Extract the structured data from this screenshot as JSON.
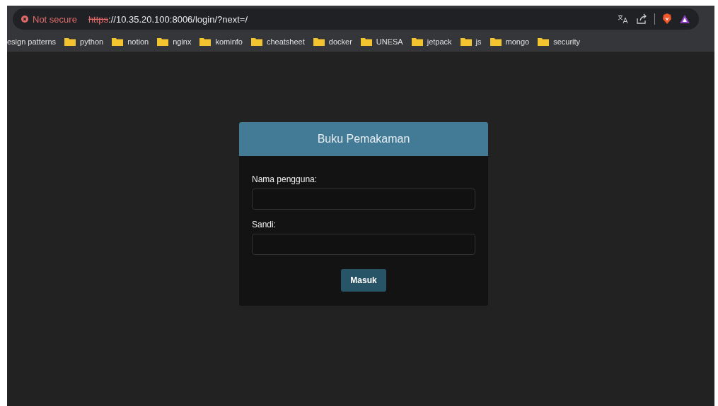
{
  "browser": {
    "security_label": "Not secure",
    "url_scheme": "https",
    "url_rest": "://10.35.20.100:8006/login/?next=/"
  },
  "bookmarks": [
    {
      "label": "esign patterns",
      "kind": "link"
    },
    {
      "label": "python",
      "kind": "folder"
    },
    {
      "label": "notion",
      "kind": "folder"
    },
    {
      "label": "nginx",
      "kind": "folder"
    },
    {
      "label": "kominfo",
      "kind": "folder"
    },
    {
      "label": "cheatsheet",
      "kind": "folder"
    },
    {
      "label": "docker",
      "kind": "folder"
    },
    {
      "label": "UNESA",
      "kind": "folder"
    },
    {
      "label": "jetpack",
      "kind": "folder"
    },
    {
      "label": "js",
      "kind": "folder"
    },
    {
      "label": "mongo",
      "kind": "folder"
    },
    {
      "label": "security",
      "kind": "folder"
    }
  ],
  "login": {
    "title": "Buku Pemakaman",
    "fields": [
      {
        "label": "Nama pengguna:"
      },
      {
        "label": "Sandi:"
      }
    ],
    "button": "Masuk"
  }
}
